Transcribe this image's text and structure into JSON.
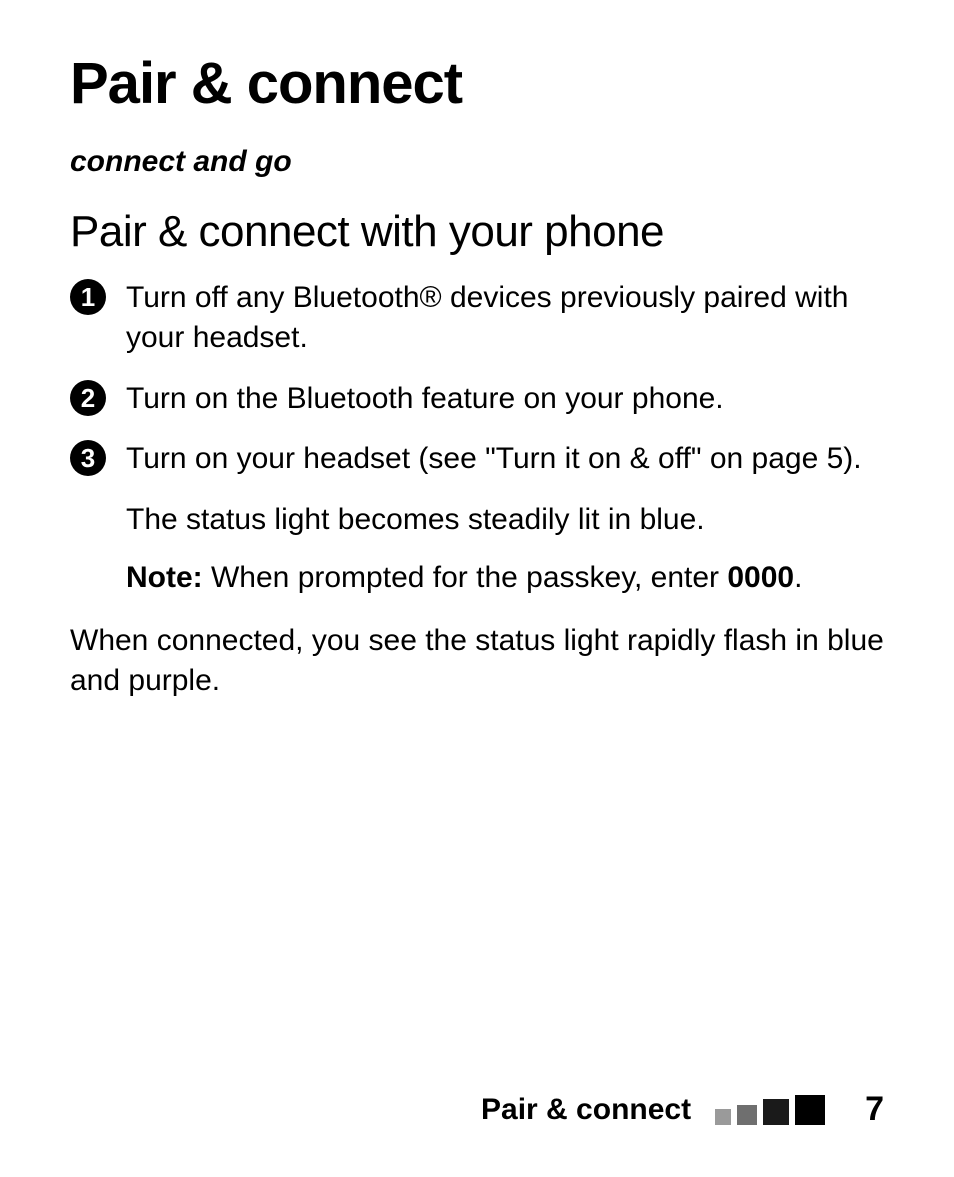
{
  "title": "Pair & connect",
  "tagline": "connect and go",
  "section_heading": "Pair & connect with your phone",
  "steps": [
    "Turn off any Bluetooth® devices previously paired with your headset.",
    "Turn on the Bluetooth feature on your phone.",
    "Turn on your headset (see \"Turn it on & off\" on page 5)."
  ],
  "status_line": "The status light becomes steadily lit in blue.",
  "note_label": "Note:",
  "note_text": " When prompted for the passkey, enter ",
  "passkey": "0000",
  "note_period": ".",
  "body": "When connected, you see the status light rapidly flash in blue and purple.",
  "footer_label": "Pair & connect",
  "page_number": "7"
}
